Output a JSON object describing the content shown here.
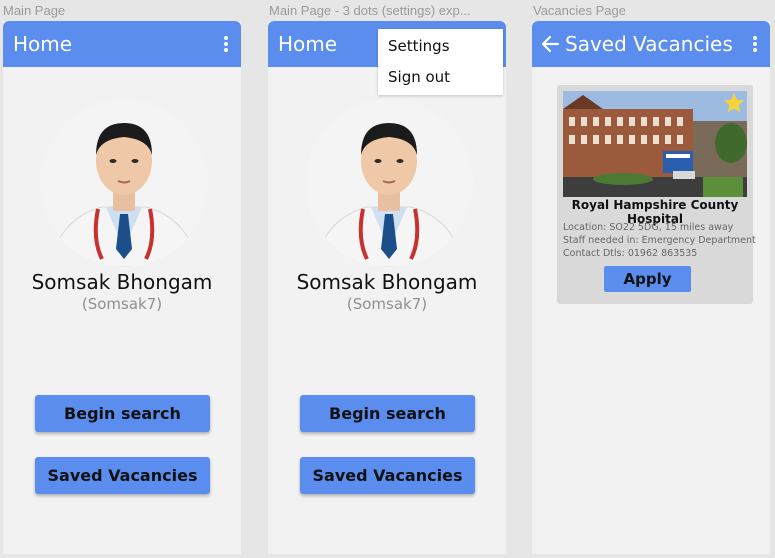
{
  "frames": [
    {
      "label": "Main Page",
      "appbar": {
        "title": "Home",
        "menu_icon": "kebab-menu-icon"
      },
      "profile": {
        "name": "Somsak Bhongam",
        "username": "(Somsak7)"
      },
      "buttons": {
        "begin_search": "Begin search",
        "saved_vacancies": "Saved Vacancies"
      }
    },
    {
      "label": "Main Page - 3 dots (settings) exp...",
      "appbar": {
        "title": "Home"
      },
      "menu": {
        "settings": "Settings",
        "sign_out": "Sign out"
      },
      "profile": {
        "name": "Somsak Bhongam",
        "username": "(Somsak7)"
      },
      "buttons": {
        "begin_search": "Begin search",
        "saved_vacancies": "Saved Vacancies"
      }
    },
    {
      "label": "Vacancies Page",
      "appbar": {
        "title": "Saved Vacancies",
        "back_icon": "back-arrow-icon",
        "menu_icon": "kebab-menu-icon"
      },
      "vacancy": {
        "hospital": "Royal Hampshire County Hospital",
        "location": "Location: SO22 5DG, 15 miles away",
        "staff": "Staff needed in: Emergency Department",
        "contact": "Contact Dtls: 01962 863535",
        "apply": "Apply",
        "favorite_icon": "star-icon"
      }
    }
  ],
  "colors": {
    "accent": "#5b8def",
    "screen_bg": "#f2f2f2",
    "canvas_bg": "#e6e6e6",
    "star": "#f5d33a"
  }
}
